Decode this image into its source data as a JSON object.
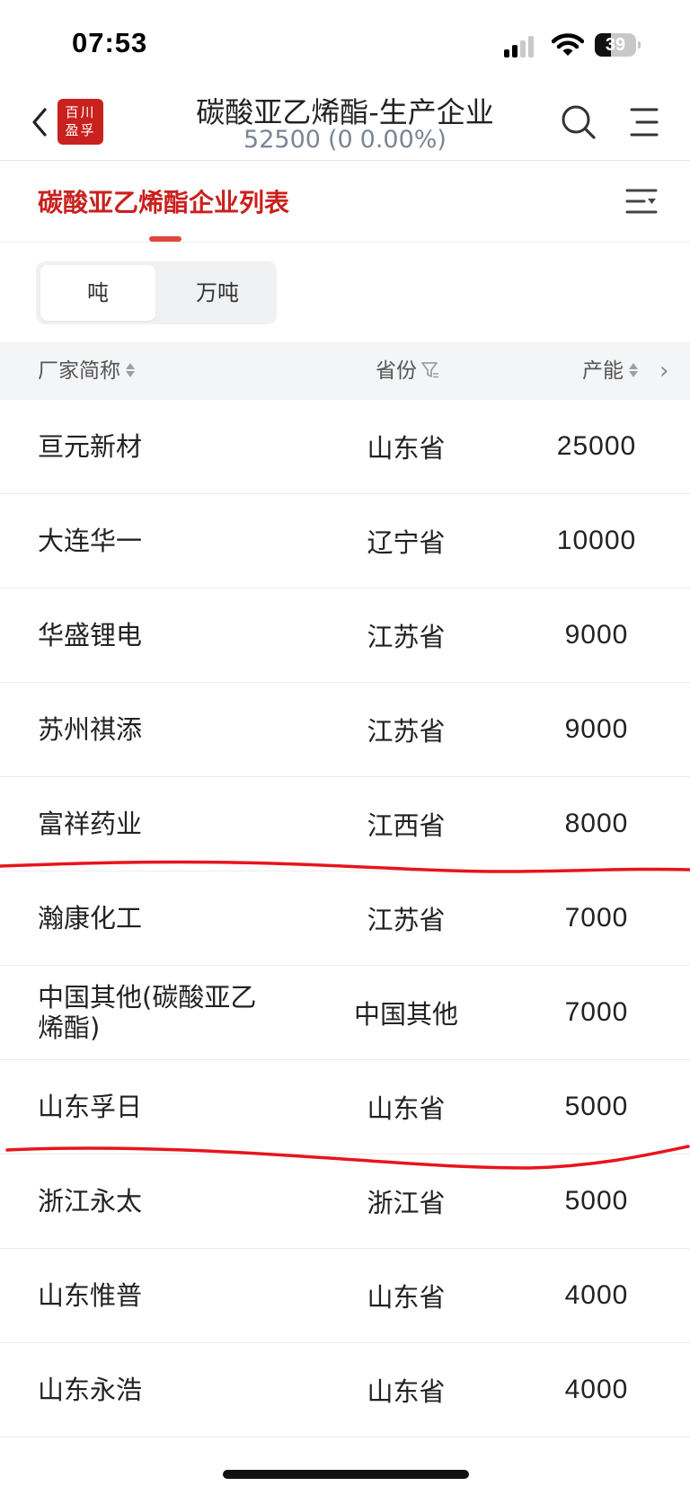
{
  "status_bar": {
    "time": "07:53",
    "battery": "39",
    "battery_level": 0.39
  },
  "header": {
    "logo_line1": "百川",
    "logo_line2": "盈孚",
    "title": "碳酸亚乙烯酯-生产企业",
    "price": "52500",
    "change_open": "(0",
    "change_pct": "0.00%)"
  },
  "tabs": {
    "active": "碳酸亚乙烯酯企业列表"
  },
  "unit_toggle": {
    "options": [
      "吨",
      "万吨"
    ],
    "selected": "吨"
  },
  "table": {
    "columns": [
      "厂家简称",
      "省份",
      "产能"
    ],
    "more": "›",
    "rows": [
      {
        "name": "亘元新材",
        "province": "山东省",
        "capacity": "25000"
      },
      {
        "name": "大连华一",
        "province": "辽宁省",
        "capacity": "10000"
      },
      {
        "name": "华盛锂电",
        "province": "江苏省",
        "capacity": "9000"
      },
      {
        "name": "苏州祺添",
        "province": "江苏省",
        "capacity": "9000"
      },
      {
        "name": "富祥药业",
        "province": "江西省",
        "capacity": "8000"
      },
      {
        "name": "瀚康化工",
        "province": "江苏省",
        "capacity": "7000"
      },
      {
        "name": "中国其他(碳酸亚乙烯酯)",
        "province": "中国其他",
        "capacity": "7000"
      },
      {
        "name": "山东孚日",
        "province": "山东省",
        "capacity": "5000"
      },
      {
        "name": "浙江永太",
        "province": "浙江省",
        "capacity": "5000"
      },
      {
        "name": "山东惟普",
        "province": "山东省",
        "capacity": "4000"
      },
      {
        "name": "山东永浩",
        "province": "山东省",
        "capacity": "4000"
      }
    ]
  },
  "colors": {
    "brand_red": "#c9211e",
    "annotation_red": "#e8141c"
  }
}
